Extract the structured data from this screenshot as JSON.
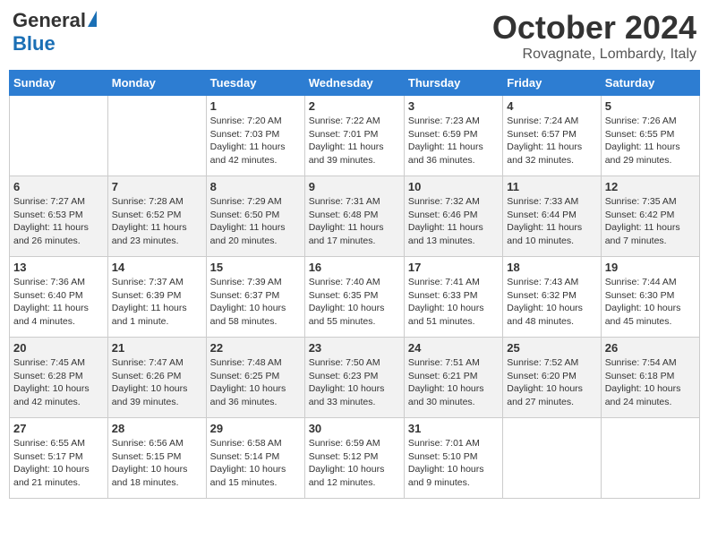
{
  "header": {
    "logo_general": "General",
    "logo_blue": "Blue",
    "month_title": "October 2024",
    "location": "Rovagnate, Lombardy, Italy"
  },
  "weekdays": [
    "Sunday",
    "Monday",
    "Tuesday",
    "Wednesday",
    "Thursday",
    "Friday",
    "Saturday"
  ],
  "weeks": [
    [
      null,
      null,
      {
        "day": 1,
        "sunrise": "7:20 AM",
        "sunset": "7:03 PM",
        "daylight": "11 hours and 42 minutes."
      },
      {
        "day": 2,
        "sunrise": "7:22 AM",
        "sunset": "7:01 PM",
        "daylight": "11 hours and 39 minutes."
      },
      {
        "day": 3,
        "sunrise": "7:23 AM",
        "sunset": "6:59 PM",
        "daylight": "11 hours and 36 minutes."
      },
      {
        "day": 4,
        "sunrise": "7:24 AM",
        "sunset": "6:57 PM",
        "daylight": "11 hours and 32 minutes."
      },
      {
        "day": 5,
        "sunrise": "7:26 AM",
        "sunset": "6:55 PM",
        "daylight": "11 hours and 29 minutes."
      }
    ],
    [
      {
        "day": 6,
        "sunrise": "7:27 AM",
        "sunset": "6:53 PM",
        "daylight": "11 hours and 26 minutes."
      },
      {
        "day": 7,
        "sunrise": "7:28 AM",
        "sunset": "6:52 PM",
        "daylight": "11 hours and 23 minutes."
      },
      {
        "day": 8,
        "sunrise": "7:29 AM",
        "sunset": "6:50 PM",
        "daylight": "11 hours and 20 minutes."
      },
      {
        "day": 9,
        "sunrise": "7:31 AM",
        "sunset": "6:48 PM",
        "daylight": "11 hours and 17 minutes."
      },
      {
        "day": 10,
        "sunrise": "7:32 AM",
        "sunset": "6:46 PM",
        "daylight": "11 hours and 13 minutes."
      },
      {
        "day": 11,
        "sunrise": "7:33 AM",
        "sunset": "6:44 PM",
        "daylight": "11 hours and 10 minutes."
      },
      {
        "day": 12,
        "sunrise": "7:35 AM",
        "sunset": "6:42 PM",
        "daylight": "11 hours and 7 minutes."
      }
    ],
    [
      {
        "day": 13,
        "sunrise": "7:36 AM",
        "sunset": "6:40 PM",
        "daylight": "11 hours and 4 minutes."
      },
      {
        "day": 14,
        "sunrise": "7:37 AM",
        "sunset": "6:39 PM",
        "daylight": "11 hours and 1 minute."
      },
      {
        "day": 15,
        "sunrise": "7:39 AM",
        "sunset": "6:37 PM",
        "daylight": "10 hours and 58 minutes."
      },
      {
        "day": 16,
        "sunrise": "7:40 AM",
        "sunset": "6:35 PM",
        "daylight": "10 hours and 55 minutes."
      },
      {
        "day": 17,
        "sunrise": "7:41 AM",
        "sunset": "6:33 PM",
        "daylight": "10 hours and 51 minutes."
      },
      {
        "day": 18,
        "sunrise": "7:43 AM",
        "sunset": "6:32 PM",
        "daylight": "10 hours and 48 minutes."
      },
      {
        "day": 19,
        "sunrise": "7:44 AM",
        "sunset": "6:30 PM",
        "daylight": "10 hours and 45 minutes."
      }
    ],
    [
      {
        "day": 20,
        "sunrise": "7:45 AM",
        "sunset": "6:28 PM",
        "daylight": "10 hours and 42 minutes."
      },
      {
        "day": 21,
        "sunrise": "7:47 AM",
        "sunset": "6:26 PM",
        "daylight": "10 hours and 39 minutes."
      },
      {
        "day": 22,
        "sunrise": "7:48 AM",
        "sunset": "6:25 PM",
        "daylight": "10 hours and 36 minutes."
      },
      {
        "day": 23,
        "sunrise": "7:50 AM",
        "sunset": "6:23 PM",
        "daylight": "10 hours and 33 minutes."
      },
      {
        "day": 24,
        "sunrise": "7:51 AM",
        "sunset": "6:21 PM",
        "daylight": "10 hours and 30 minutes."
      },
      {
        "day": 25,
        "sunrise": "7:52 AM",
        "sunset": "6:20 PM",
        "daylight": "10 hours and 27 minutes."
      },
      {
        "day": 26,
        "sunrise": "7:54 AM",
        "sunset": "6:18 PM",
        "daylight": "10 hours and 24 minutes."
      }
    ],
    [
      {
        "day": 27,
        "sunrise": "6:55 AM",
        "sunset": "5:17 PM",
        "daylight": "10 hours and 21 minutes."
      },
      {
        "day": 28,
        "sunrise": "6:56 AM",
        "sunset": "5:15 PM",
        "daylight": "10 hours and 18 minutes."
      },
      {
        "day": 29,
        "sunrise": "6:58 AM",
        "sunset": "5:14 PM",
        "daylight": "10 hours and 15 minutes."
      },
      {
        "day": 30,
        "sunrise": "6:59 AM",
        "sunset": "5:12 PM",
        "daylight": "10 hours and 12 minutes."
      },
      {
        "day": 31,
        "sunrise": "7:01 AM",
        "sunset": "5:10 PM",
        "daylight": "10 hours and 9 minutes."
      },
      null,
      null
    ]
  ]
}
